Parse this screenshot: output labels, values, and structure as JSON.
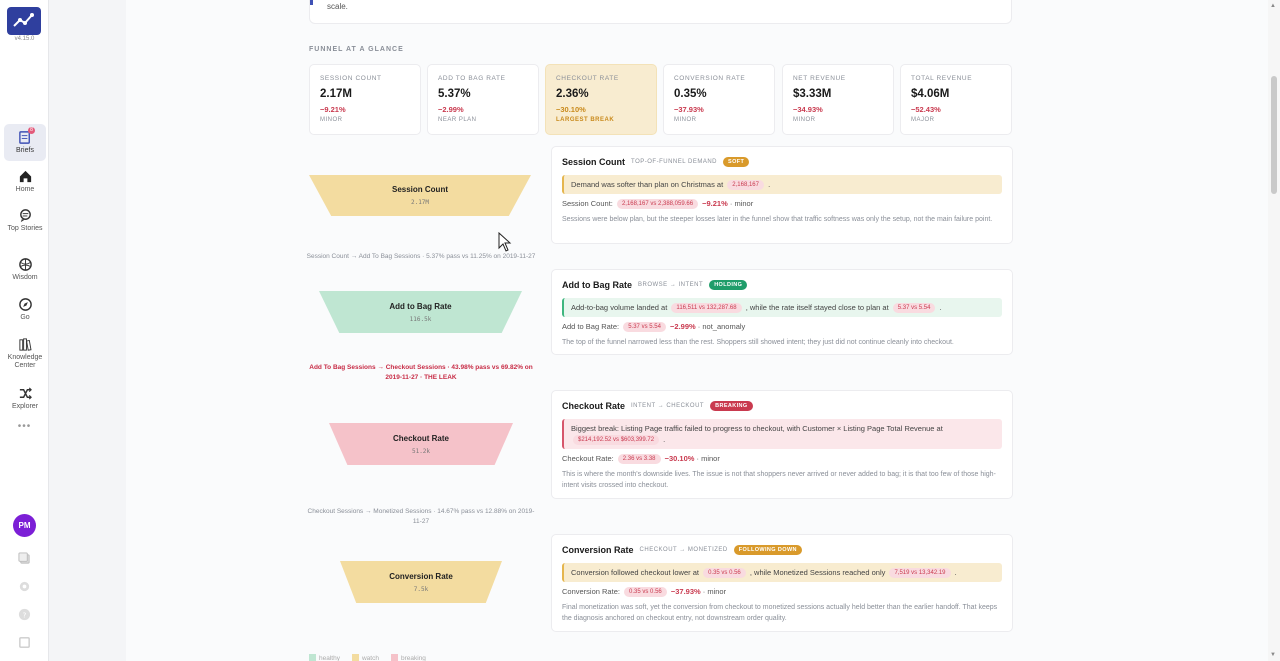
{
  "app": {
    "version": "v4.15.0"
  },
  "nav": {
    "items": [
      {
        "label": "Briefs",
        "badge": "8"
      },
      {
        "label": "Home"
      },
      {
        "label": "Top Stories"
      },
      {
        "label": "Wisdom"
      },
      {
        "label": "Go"
      },
      {
        "label": "Knowledge Center"
      },
      {
        "label": "Explorer"
      }
    ],
    "more": "•••",
    "avatar": "PM"
  },
  "top_card": {
    "text": "scale."
  },
  "section_label": "FUNNEL AT A GLANCE",
  "kpis": [
    {
      "label": "SESSION COUNT",
      "value": "2.17M",
      "change": "−9.21%",
      "severity": "MINOR"
    },
    {
      "label": "ADD TO BAG RATE",
      "value": "5.37%",
      "change": "−2.99%",
      "severity": "NEAR PLAN"
    },
    {
      "label": "CHECKOUT RATE",
      "value": "2.36%",
      "change": "−30.10%",
      "severity": "LARGEST BREAK"
    },
    {
      "label": "CONVERSION RATE",
      "value": "0.35%",
      "change": "−37.93%",
      "severity": "MINOR"
    },
    {
      "label": "NET REVENUE",
      "value": "$3.33M",
      "change": "−34.93%",
      "severity": "MINOR"
    },
    {
      "label": "TOTAL REVENUE",
      "value": "$4.06M",
      "change": "−52.43%",
      "severity": "MAJOR"
    }
  ],
  "funnel": {
    "stages": [
      {
        "title": "Session Count",
        "value": "2.17M",
        "color": "#f3dca0"
      },
      {
        "title": "Add to Bag Rate",
        "value": "116.5k",
        "color": "#bfe6d2"
      },
      {
        "title": "Checkout Rate",
        "value": "51.2k",
        "color": "#f5c2c9"
      },
      {
        "title": "Conversion Rate",
        "value": "7.5k",
        "color": "#f3dca0"
      }
    ],
    "flows": [
      {
        "text": "Session Count → Add To Bag Sessions · 5.37% pass vs 11.25% on 2019-11-27"
      },
      {
        "text": "Add To Bag Sessions → Checkout Sessions · 43.98% pass vs 69.82% on 2019-11-27",
        "tag": "· THE LEAK"
      },
      {
        "text": "Checkout Sessions → Monetized Sessions · 14.67% pass vs 12.88% on 2019-11-27"
      }
    ]
  },
  "cards": [
    {
      "title": "Session Count",
      "subtitle": "TOP-OF-FUNNEL DEMAND",
      "pill": "SOFT",
      "pill_color": "#d99a2b",
      "callout_bg": "#f8ecd0",
      "callout_border": "#e5b64e",
      "callout_a": "Demand was softer than plan on Christmas at",
      "chip_a": "2,168,167",
      "callout_b": ".",
      "chip_b": "",
      "callout_c": "",
      "metric_label": "Session Count:",
      "metric_chip": "2,168,167 vs 2,388,059.66",
      "metric_delta": "−9.21%",
      "metric_sev": "· minor",
      "desc": "Sessions were below plan, but the steeper losses later in the funnel show that traffic softness was only the setup, not the main failure point."
    },
    {
      "title": "Add to Bag Rate",
      "subtitle": "BROWSE → INTENT",
      "pill": "HOLDING",
      "pill_color": "#1f9d6a",
      "callout_bg": "#e8f6ee",
      "callout_border": "#3fb67f",
      "callout_a": "Add-to-bag volume landed at",
      "chip_a": "116,511 vs 132,287.68",
      "callout_b": ", while the rate itself stayed close to plan at",
      "chip_b": "5.37 vs 5.54",
      "callout_c": ".",
      "metric_label": "Add to Bag Rate:",
      "metric_chip": "5.37 vs 5.54",
      "metric_delta": "−2.99%",
      "metric_sev": "· not_anomaly",
      "desc": "The top of the funnel narrowed less than the rest. Shoppers still showed intent; they just did not continue cleanly into checkout."
    },
    {
      "title": "Checkout Rate",
      "subtitle": "INTENT → CHECKOUT",
      "pill": "BREAKING",
      "pill_color": "#c93a4f",
      "callout_bg": "#fbe7ea",
      "callout_border": "#d6566b",
      "callout_a": "Biggest break: Listing Page traffic failed to progress to checkout, with Customer × Listing Page Total Revenue at",
      "chip_a": "$214,192.52 vs $603,399.72",
      "callout_b": ".",
      "chip_b": "",
      "callout_c": "",
      "metric_label": "Checkout Rate:",
      "metric_chip": "2.36 vs 3.38",
      "metric_delta": "−30.10%",
      "metric_sev": "· minor",
      "desc": "This is where the month's downside lives. The issue is not that shoppers never arrived or never added to bag; it is that too few of those high-intent visits crossed into checkout."
    },
    {
      "title": "Conversion Rate",
      "subtitle": "CHECKOUT → MONETIZED",
      "pill": "FOLLOWING DOWN",
      "pill_color": "#d99a2b",
      "callout_bg": "#f8ecd0",
      "callout_border": "#e5b64e",
      "callout_a": "Conversion followed checkout lower at",
      "chip_a": "0.35 vs 0.56",
      "callout_b": ", while Monetized Sessions reached only",
      "chip_b": "7,519 vs 13,342.19",
      "callout_c": ".",
      "metric_label": "Conversion Rate:",
      "metric_chip": "0.35 vs 0.56",
      "metric_delta": "−37.93%",
      "metric_sev": "· minor",
      "desc": "Final monetization was soft, yet the conversion from checkout to monetized sessions actually held better than the earlier handoff. That keeps the diagnosis anchored on checkout entry, not downstream order quality."
    }
  ],
  "legend": [
    {
      "label": "healthy",
      "color": "#bfe6d2"
    },
    {
      "label": "watch",
      "color": "#f3dca0"
    },
    {
      "label": "breaking",
      "color": "#f5c2c9"
    }
  ]
}
